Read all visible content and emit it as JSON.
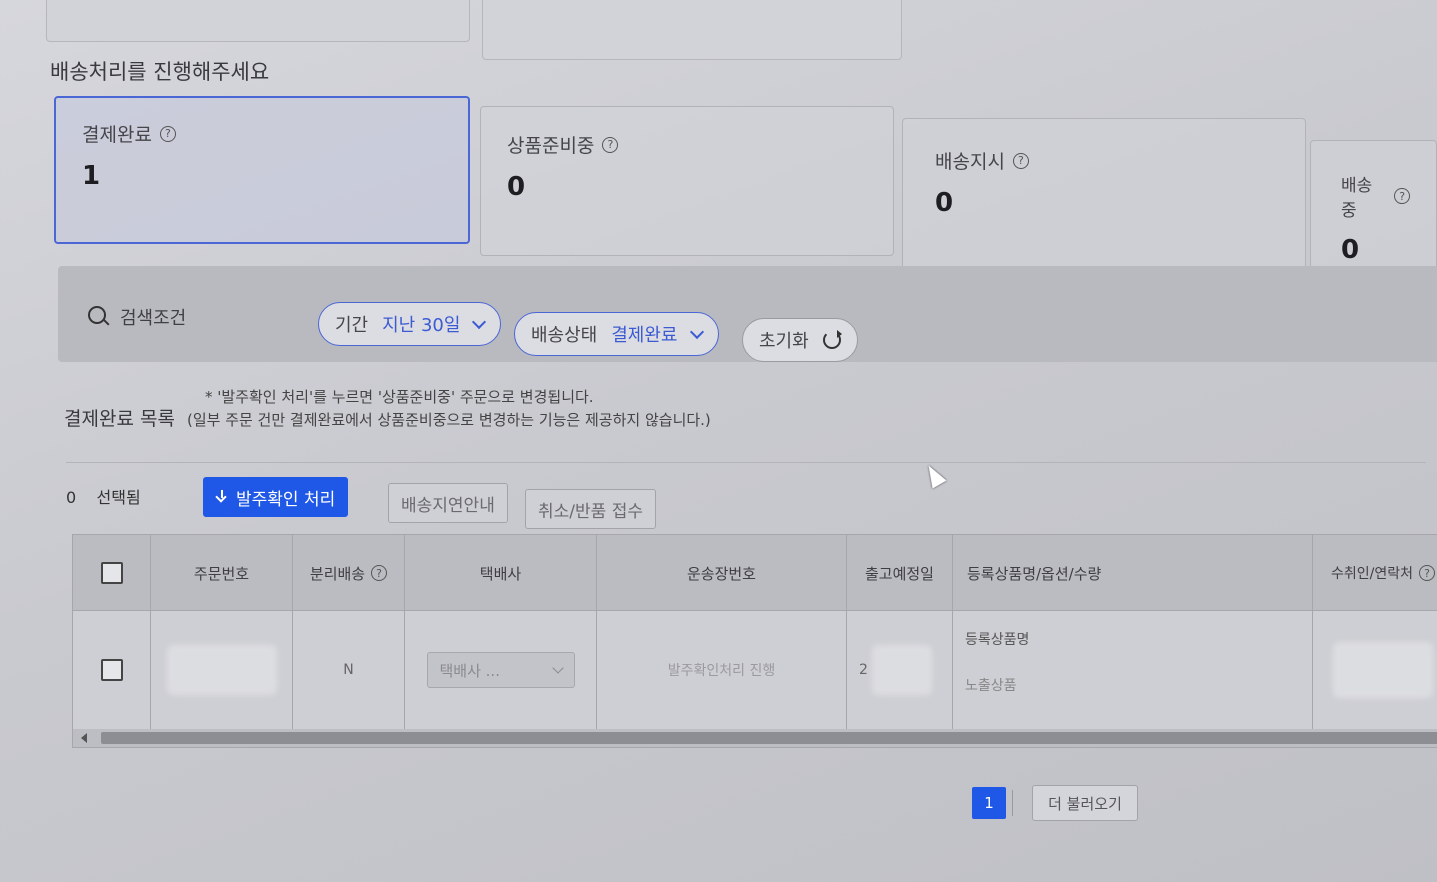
{
  "section_title": "배송처리를 진행해주세요",
  "status_cards": [
    {
      "label": "결제완료",
      "count": "1",
      "active": true
    },
    {
      "label": "상품준비중",
      "count": "0",
      "active": false
    },
    {
      "label": "배송지시",
      "count": "0",
      "active": false
    },
    {
      "label": "배송중",
      "count": "0",
      "active": false
    }
  ],
  "filter": {
    "search_label": "검색조건",
    "period_label": "기간",
    "period_value": "지난 30일",
    "status_label": "배송상태",
    "status_value": "결제완료",
    "reset_label": "초기화"
  },
  "list": {
    "notice": "* '발주확인 처리'를 누르면 '상품준비중' 주문으로 변경됩니다.",
    "title": "결제완료 목록",
    "subtitle": "(일부 주문 건만 결제완료에서 상품준비중으로 변경하는 기능은 제공하지 않습니다.)",
    "selected_count": "0",
    "selected_label": "선택됨"
  },
  "actions": {
    "confirm_order": "발주확인 처리",
    "delay_notice": "배송지연안내",
    "cancel_return": "취소/반품 접수"
  },
  "table": {
    "headers": {
      "order_no": "주문번호",
      "split_ship": "분리배송",
      "courier": "택배사",
      "tracking": "운송장번호",
      "ship_date": "출고예정일",
      "product": "등록상품명/옵션/수량",
      "receiver": "수취인/연락처"
    },
    "row": {
      "split_ship": "N",
      "courier_placeholder": "택배사 ...",
      "tracking_placeholder": "발주확인처리 진행",
      "ship_date_prefix": "2",
      "product_label": "등록상품명",
      "exposure_label": "노출상품"
    }
  },
  "pagination": {
    "current_page": "1",
    "load_more": "더 불러오기"
  }
}
